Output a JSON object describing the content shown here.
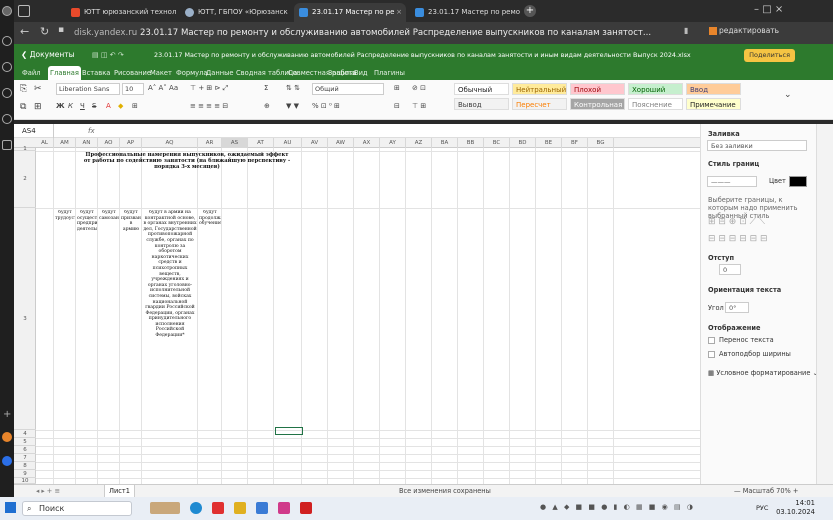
{
  "browser": {
    "tabs": [
      {
        "label": "ЮТТ юрюзанский технол",
        "icon": "yandex-icon"
      },
      {
        "label": "ЮТТ, ГБПОУ «Юрюзанск",
        "icon": "circle-icon"
      },
      {
        "label": "23.01.17 Мастер по ре",
        "icon": "sheet-icon"
      },
      {
        "label": "23.01.17 Мастер по ремо",
        "icon": "sheet-icon"
      }
    ],
    "host": "disk.yandex.ru",
    "page_title": "23.01.17 Мастер по ремонту и обслуживанию автомобилей Распределение выпускников по каналам занятост...",
    "edit_label": "редактировать"
  },
  "app": {
    "docs_label": "Документы",
    "doc_title": "23.01.17 Мастер по ремонту и обслуживанию автомобилей Распределение выпускников по каналам занятости и иным видам деятельности Выпуск 2024.xlsx",
    "share_label": "Поделиться",
    "menu": [
      "Файл",
      "Главная",
      "Вставка",
      "Рисование",
      "Макет",
      "Формула",
      "Данные",
      "Сводная таблица",
      "Совместная работа",
      "Защита",
      "Вид",
      "Плагины"
    ],
    "active_menu": "Главная"
  },
  "ribbon": {
    "font_name": "Liberation Sans",
    "font_size": "10",
    "number_format": "Общий",
    "styles": [
      {
        "label": "Обычный",
        "bg": "#ffffff",
        "fg": "#222222"
      },
      {
        "label": "Нейтральный",
        "bg": "#ffeb9c",
        "fg": "#9c6500"
      },
      {
        "label": "Плохой",
        "bg": "#ffc7ce",
        "fg": "#9c0006"
      },
      {
        "label": "Хороший",
        "bg": "#c6efce",
        "fg": "#006100"
      },
      {
        "label": "Ввод",
        "bg": "#ffcc99",
        "fg": "#3f3f76"
      },
      {
        "label": "Вывод",
        "bg": "#f2f2f2",
        "fg": "#3f3f3f"
      },
      {
        "label": "Пересчет",
        "bg": "#f2f2f2",
        "fg": "#fa7d00"
      },
      {
        "label": "Контрольная я",
        "bg": "#a5a5a5",
        "fg": "#ffffff"
      },
      {
        "label": "Пояснение",
        "bg": "#ffffff",
        "fg": "#7f7f7f"
      },
      {
        "label": "Примечание",
        "bg": "#ffffcc",
        "fg": "#222222"
      }
    ]
  },
  "formula": {
    "cell_ref": "AS4",
    "fx": "fx"
  },
  "grid": {
    "columns": [
      "AL",
      "AM",
      "AN",
      "AO",
      "AP",
      "AQ",
      "AR",
      "AS",
      "AT",
      "AU",
      "AV",
      "AW",
      "AX",
      "AY",
      "AZ",
      "BA",
      "BB",
      "BC",
      "BD",
      "BE",
      "BF",
      "BG"
    ],
    "selected_column": "AS",
    "rows": [
      "1",
      "2",
      "3",
      "4",
      "5",
      "6",
      "7",
      "8",
      "9",
      "10"
    ],
    "title": "Профессиональные намерения выпускников, ожидаемый эффект от работы по содействию занятости (на ближайшую перспективу - порядка 3-х месяцев)",
    "headers": [
      "будут трудоустроены",
      "будут осуществлять предпринимательскую деятельность",
      "будут самозанятыми",
      "будут призваны в армию",
      "будут в армии на контрактной основе, в органах внутренних дел, Государственной противопожарной службе, органах по контролю за оборотом наркотических средств и психотропных веществ, учреждениях и органах уголовно-исполнительной системы, войсках национальной гвардии Российской Федерации, органах принудительного исполнения Российской Федерации*",
      "будут продолжать обучение"
    ]
  },
  "panel": {
    "fill_label": "Заливка",
    "fill_value": "Без заливки",
    "border_style_label": "Стиль границ",
    "color_label": "Цвет",
    "border_hint": "Выберите границы, к которым надо применить выбранный стиль",
    "indent_label": "Отступ",
    "indent_value": "0",
    "orientation_label": "Ориентация текста",
    "angle_label": "Угол",
    "angle_value": "0°",
    "display_label": "Отображение",
    "wrap_label": "Перенос текста",
    "autofit_label": "Автоподбор ширины",
    "conditional_label": "Условное форматирование"
  },
  "sheetbar": {
    "sheet_name": "Лист1",
    "saved_status": "Все изменения сохранены",
    "zoom": "Масштаб 70%"
  },
  "taskbar": {
    "search_placeholder": "Поиск",
    "lang": "РУС",
    "time": "14:01",
    "date": "03.10.2024"
  },
  "colors": {
    "accent": "#2d7a2d",
    "share": "#f5c443"
  }
}
